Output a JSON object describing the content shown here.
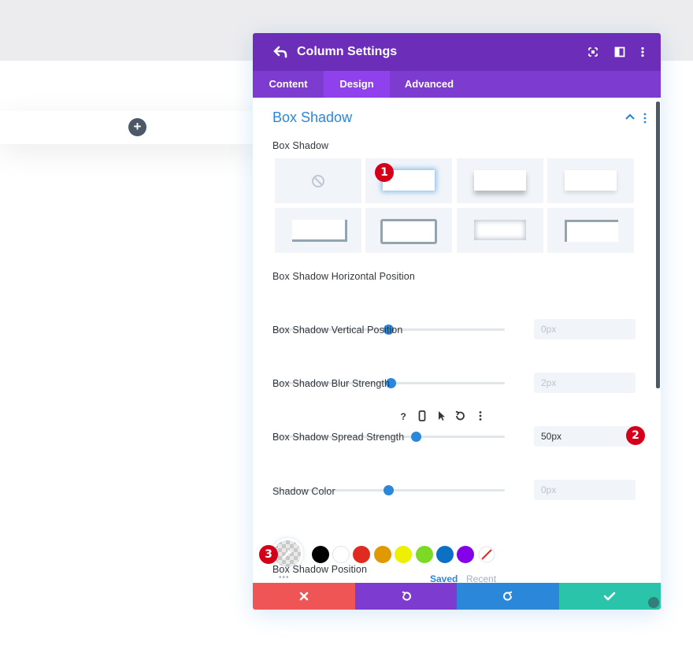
{
  "modal": {
    "title": "Column Settings",
    "tabs": [
      "Content",
      "Design",
      "Advanced"
    ],
    "active_tab": "Design"
  },
  "section": {
    "title": "Box Shadow",
    "box_shadow_label": "Box Shadow"
  },
  "fields": {
    "horizontal": {
      "label": "Box Shadow Horizontal Position",
      "value": "0px",
      "level": 0.5
    },
    "vertical": {
      "label": "Box Shadow Vertical Position",
      "value": "2px",
      "level": 0.51
    },
    "blur": {
      "label": "Box Shadow Blur Strength",
      "value": "50px",
      "level": 0.62
    },
    "spread": {
      "label": "Box Shadow Spread Strength",
      "value": "0px",
      "level": 0.5
    }
  },
  "shadow_color": {
    "label": "Shadow Color",
    "swatches": [
      "#000000",
      "#ffffff",
      "#e02b20",
      "#e09900",
      "#edf000",
      "#7cda24",
      "#0c71c3",
      "#8300e9"
    ],
    "saved_label": "Saved",
    "recent_label": "Recent",
    "more_label": "•••"
  },
  "position_label": "Box Shadow Position",
  "badges": [
    "1",
    "2",
    "3"
  ],
  "colors": {
    "header": "#6c2eb9",
    "tabs": "#7e3bd0",
    "accent": "#2b87da",
    "cancel": "#ef5555",
    "undo": "#7e3bd0",
    "redo": "#2b87da",
    "save": "#29c4a9"
  },
  "icons": {
    "back": "undo-arrow-icon",
    "expand": "fullscreen-icon",
    "split": "split-view-icon",
    "more": "kebab-menu-icon"
  }
}
